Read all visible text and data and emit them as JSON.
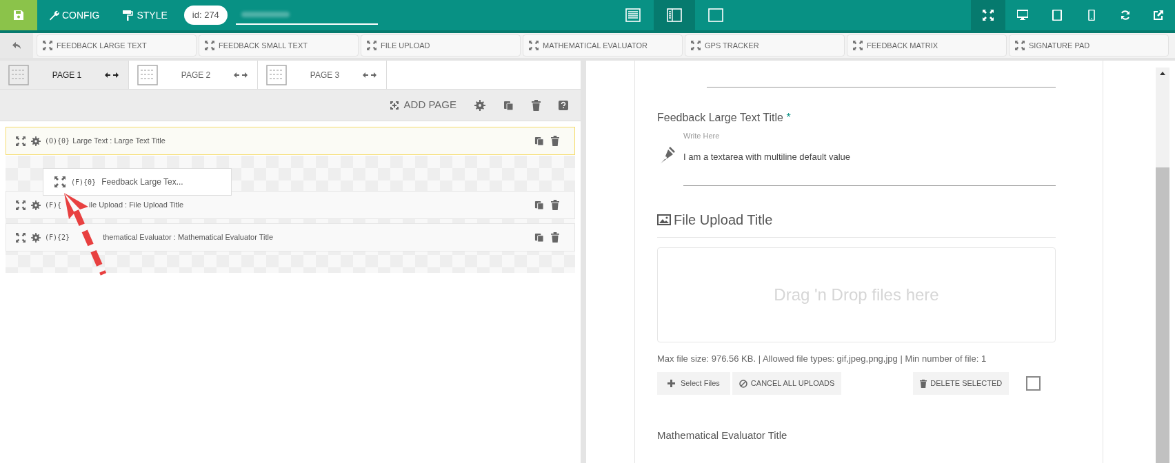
{
  "topbar": {
    "config": "CONFIG",
    "style": "STYLE",
    "id_badge": "id: 274"
  },
  "view_modes": [
    {
      "kind": "list",
      "selected": false
    },
    {
      "kind": "split",
      "selected": true
    },
    {
      "kind": "blank",
      "selected": false
    }
  ],
  "device_modes": [
    {
      "kind": "expand",
      "selected": true
    },
    {
      "kind": "desktop",
      "selected": false
    },
    {
      "kind": "tablet",
      "selected": false
    },
    {
      "kind": "phone",
      "selected": false
    }
  ],
  "components": [
    "FEEDBACK LARGE TEXT",
    "FEEDBACK SMALL TEXT",
    "FILE UPLOAD",
    "MATHEMATICAL EVALUATOR",
    "GPS TRACKER",
    "FEEDBACK MATRIX",
    "SIGNATURE PAD"
  ],
  "pages": [
    {
      "label": "PAGE 1",
      "selected": true
    },
    {
      "label": "PAGE 2",
      "selected": false
    },
    {
      "label": "PAGE 3",
      "selected": false
    }
  ],
  "page_toolbar": {
    "add_page": "ADD PAGE"
  },
  "fields": [
    {
      "prefix": "(O){0}",
      "text": "Large Text : Large Text Title",
      "selected": true
    },
    {
      "prefix": "(F){",
      "text": "ile Upload : File Upload Title",
      "selected": false
    },
    {
      "prefix": "(F){2}",
      "text": "thematical Evaluator : Mathematical Evaluator Title",
      "selected": false
    }
  ],
  "drag_ghost": {
    "prefix": "(F){0}",
    "text": "Feedback Large Tex..."
  },
  "preview": {
    "large_text": {
      "title": "Feedback Large Text Title",
      "required": "*",
      "label": "Write Here",
      "value": "I am a textarea with multiline default value"
    },
    "file_upload": {
      "title": "File Upload Title",
      "drop": "Drag 'n Drop files here",
      "info": "Max file size: 976.56 KB. | Allowed file types: gif,jpeg,png,jpg | Min number of file: 1",
      "select": "Select Files",
      "cancel": "CANCEL ALL UPLOADS",
      "delete": "DELETE SELECTED",
      "checked": false
    },
    "math_title": "Mathematical Evaluator Title"
  }
}
